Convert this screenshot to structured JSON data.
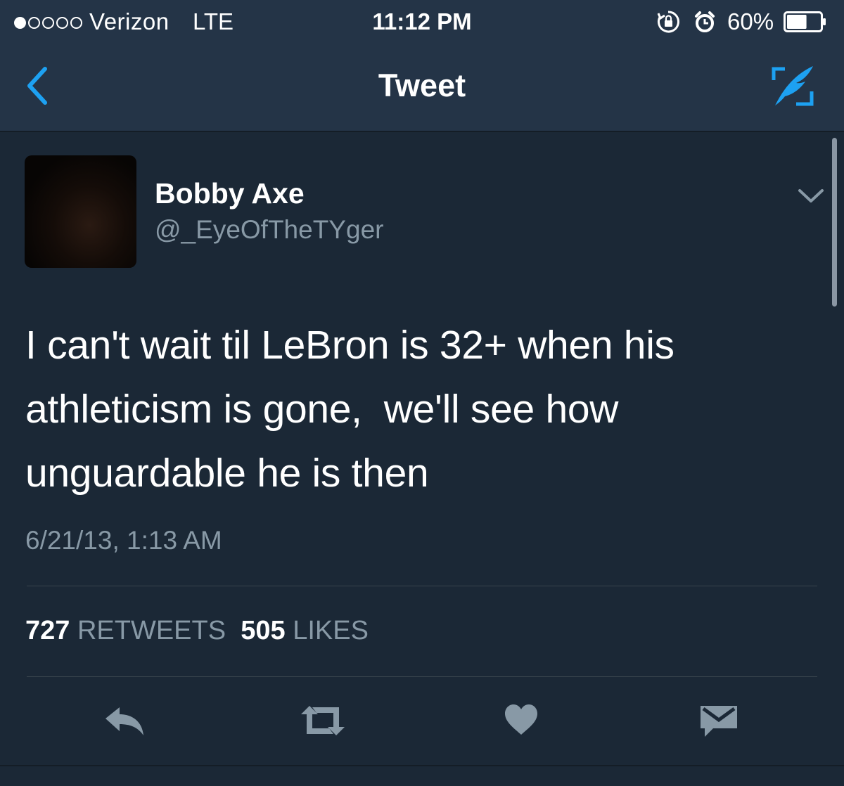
{
  "status_bar": {
    "carrier": "Verizon",
    "network": "LTE",
    "time": "11:12 PM",
    "battery": "60%",
    "battery_level": 0.6
  },
  "nav": {
    "title": "Tweet",
    "back_icon": "chevron-left-icon",
    "compose_icon": "compose-tweet-icon"
  },
  "tweet": {
    "author_name": "Bobby Axe",
    "author_handle": "@_EyeOfTheTYger",
    "text": "I can't wait til LeBron is 32+ when his athleticism is gone,  we'll see how unguardable he is then",
    "timestamp": "6/21/13, 1:13 AM",
    "retweet_count": "727",
    "retweet_label": "RETWEETS",
    "like_count": "505",
    "like_label": "LIKES"
  },
  "actions": [
    "reply-icon",
    "retweet-icon",
    "heart-icon",
    "direct-message-icon"
  ],
  "colors": {
    "background": "#1b2836",
    "header": "#243447",
    "accent": "#1da1f2",
    "secondary_text": "#8899a6",
    "icon": "#8899a6"
  }
}
